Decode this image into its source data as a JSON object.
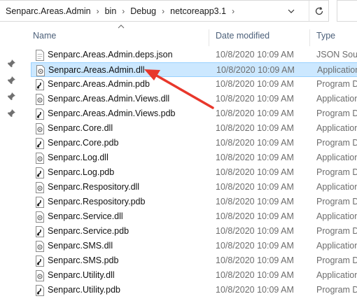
{
  "breadcrumb": [
    "Senparc.Areas.Admin",
    "bin",
    "Debug",
    "netcoreapp3.1"
  ],
  "columns": {
    "name": "Name",
    "date": "Date modified",
    "type": "Type"
  },
  "files": [
    {
      "name": "Senparc.Areas.Admin.deps.json",
      "date": "10/8/2020 10:09 AM",
      "type": "JSON Sourc",
      "icon": "json-file-icon"
    },
    {
      "name": "Senparc.Areas.Admin.dll",
      "date": "10/8/2020 10:09 AM",
      "type": "Application",
      "icon": "dll-file-icon",
      "selected": true
    },
    {
      "name": "Senparc.Areas.Admin.pdb",
      "date": "10/8/2020 10:09 AM",
      "type": "Program D",
      "icon": "pdb-file-icon"
    },
    {
      "name": "Senparc.Areas.Admin.Views.dll",
      "date": "10/8/2020 10:09 AM",
      "type": "Application",
      "icon": "dll-file-icon"
    },
    {
      "name": "Senparc.Areas.Admin.Views.pdb",
      "date": "10/8/2020 10:09 AM",
      "type": "Program D",
      "icon": "pdb-file-icon"
    },
    {
      "name": "Senparc.Core.dll",
      "date": "10/8/2020 10:09 AM",
      "type": "Application",
      "icon": "dll-file-icon"
    },
    {
      "name": "Senparc.Core.pdb",
      "date": "10/8/2020 10:09 AM",
      "type": "Program D",
      "icon": "pdb-file-icon"
    },
    {
      "name": "Senparc.Log.dll",
      "date": "10/8/2020 10:09 AM",
      "type": "Application",
      "icon": "dll-file-icon"
    },
    {
      "name": "Senparc.Log.pdb",
      "date": "10/8/2020 10:09 AM",
      "type": "Program D",
      "icon": "pdb-file-icon"
    },
    {
      "name": "Senparc.Respository.dll",
      "date": "10/8/2020 10:09 AM",
      "type": "Application",
      "icon": "dll-file-icon"
    },
    {
      "name": "Senparc.Respository.pdb",
      "date": "10/8/2020 10:09 AM",
      "type": "Program D",
      "icon": "pdb-file-icon"
    },
    {
      "name": "Senparc.Service.dll",
      "date": "10/8/2020 10:09 AM",
      "type": "Application",
      "icon": "dll-file-icon"
    },
    {
      "name": "Senparc.Service.pdb",
      "date": "10/8/2020 10:09 AM",
      "type": "Program D",
      "icon": "pdb-file-icon"
    },
    {
      "name": "Senparc.SMS.dll",
      "date": "10/8/2020 10:09 AM",
      "type": "Application",
      "icon": "dll-file-icon"
    },
    {
      "name": "Senparc.SMS.pdb",
      "date": "10/8/2020 10:09 AM",
      "type": "Program D",
      "icon": "pdb-file-icon"
    },
    {
      "name": "Senparc.Utility.dll",
      "date": "10/8/2020 10:09 AM",
      "type": "Application",
      "icon": "dll-file-icon"
    },
    {
      "name": "Senparc.Utility.pdb",
      "date": "10/8/2020 10:09 AM",
      "type": "Program D",
      "icon": "pdb-file-icon"
    }
  ],
  "colors": {
    "selection": "#cce8ff",
    "selection_border": "#99d1ff",
    "header_text": "#4c607a",
    "arrow": "#e8372b"
  }
}
